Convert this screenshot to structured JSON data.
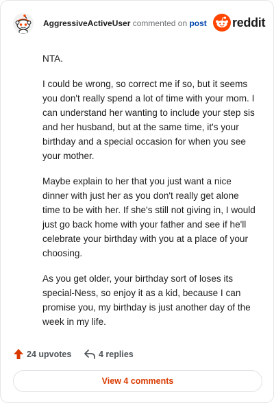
{
  "header": {
    "username": "AggressiveActiveUser",
    "action_text": " commented on ",
    "post_link": "post",
    "brand_name": "reddit",
    "brand_color": "#ff4500"
  },
  "comment": {
    "paragraphs": [
      "NTA.",
      "I could be wrong, so correct me if so, but it seems you don't really spend a lot of time with your mom. I can understand her wanting to include your step sis and her husband, but at the same time, it's your birthday and a special occasion for when you see your mother.",
      "Maybe explain to her that you just want a nice dinner with just her as you don't really get alone time to be with her. If she's still not giving in, I would just go back home with your father and see if he'll celebrate your birthday with you at a place of your choosing.",
      "As you get older, your birthday sort of loses its special-Ness, so enjoy it as a kid, because I can promise you, my birthday is just another day of the week in my life."
    ]
  },
  "footer": {
    "upvotes_label": "24 upvotes",
    "replies_label": "4 replies",
    "view_comments_label": "View 4 comments",
    "upvote_icon": "upvote-arrow-icon",
    "reply_icon": "reply-arrow-icon",
    "accent_color": "#d93a00"
  }
}
